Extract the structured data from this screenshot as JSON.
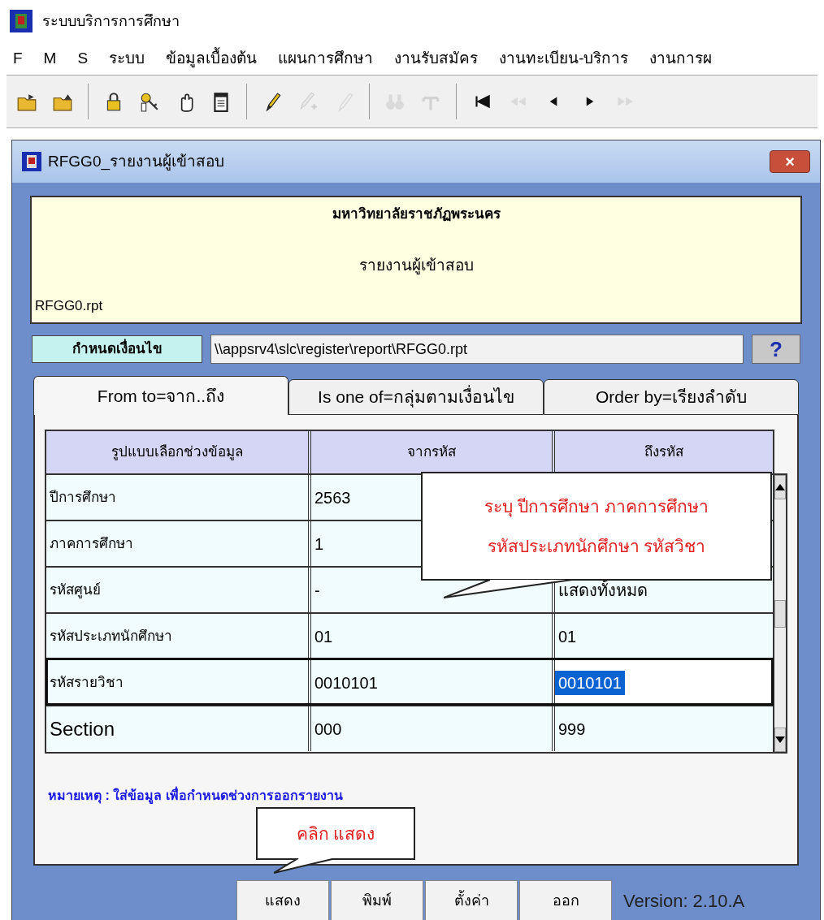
{
  "app": {
    "title": "ระบบบริการการศึกษา"
  },
  "menu": [
    "F",
    "M",
    "S",
    "ระบบ",
    "ข้อมูลเบื้องต้น",
    "แผนการศึกษา",
    "งานรับสมัคร",
    "งานทะเบียน-บริการ",
    "งานการผ"
  ],
  "toolbar": [
    {
      "disabled": false
    },
    {
      "disabled": false
    },
    {
      "disabled": false
    },
    {
      "disabled": false
    },
    {
      "disabled": false
    },
    {
      "disabled": false
    },
    {
      "disabled": false
    },
    {
      "disabled": true
    },
    {
      "disabled": true
    },
    {
      "disabled": true
    },
    {
      "disabled": true
    },
    {
      "disabled": false
    },
    {
      "disabled": true
    },
    {
      "disabled": false
    },
    {
      "disabled": false
    },
    {
      "disabled": true
    }
  ],
  "dialog": {
    "title": "RFGG0_รายงานผู้เข้าสอบ",
    "close": "×"
  },
  "header": {
    "university": "มหาวิทยาลัยราชภัฏพระนคร",
    "report": "รายงานผู้เข้าสอบ",
    "file": "RFGG0.rpt"
  },
  "condition": {
    "label": "กำหนดเงื่อนไข",
    "path": "\\\\appsrv4\\slc\\register\\report\\RFGG0.rpt",
    "help": "?"
  },
  "tabs": [
    {
      "label": "From to=จาก..ถึง",
      "selected": true
    },
    {
      "label": "Is one of=กลุ่มตามเงื่อนไข",
      "selected": false
    },
    {
      "label": "Order by=เรียงลำดับ",
      "selected": false
    }
  ],
  "table": {
    "columns": [
      "รูปแบบเลือกช่วงข้อมูล",
      "จากรหัส",
      "ถึงรหัส"
    ],
    "rows": [
      {
        "name": "ปีการศึกษา",
        "from": "2563",
        "selected": false
      },
      {
        "name": "ภาคการศึกษา",
        "from": "1",
        "selected": false
      },
      {
        "name": "รหัสศูนย์",
        "from": "-",
        "to": "แสดงทั้งหมด",
        "selected": false
      },
      {
        "name": "รหัสประเภทนักศึกษา",
        "from": "01",
        "to": "01",
        "selected": false
      },
      {
        "name": "รหัสรายวิชา",
        "from": "0010101",
        "to": "0010101",
        "selected": true
      },
      {
        "name": "Section",
        "from": "000",
        "to": "999",
        "selected": false
      }
    ]
  },
  "note": "หมายเหตุ : ใส่ข้อมูล เพื่อกำหนดช่วงการออกรายงาน",
  "callouts": [
    {
      "lines": [
        "ระบุ ปีการศึกษา ภาคการศึกษา",
        "รหัสประเภทนักศึกษา รหัสวิชา"
      ]
    },
    {
      "lines": [
        "คลิก แสดง"
      ]
    }
  ],
  "buttons": [
    "แสดง",
    "พิมพ์",
    "ตั้งค่า",
    "ออก"
  ],
  "version": "Version: 2.10.A"
}
